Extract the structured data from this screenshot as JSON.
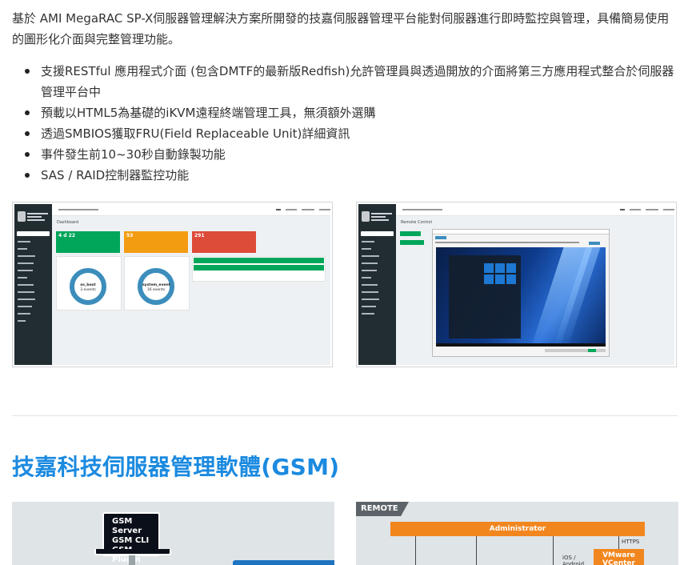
{
  "intro": {
    "text": "基於 AMI MegaRAC SP-X伺服器管理解決方案所開發的技嘉伺服器管理平台能對伺服器進行即時監控與管理，具備簡易使用的圖形化介面與完整管理功能。"
  },
  "features": [
    "支援RESTful 應用程式介面 (包含DMTF的最新版Redfish)允許管理員與透過開放的介面將第三方應用程式整合於伺服器管理平台中",
    "預載以HTML5為基礎的iKVM遠程終端管理工具，無須額外選購",
    "透過SMBIOS獲取FRU(Field Replaceable Unit)詳細資訊",
    "事件發生前10~30秒自動錄製功能",
    "SAS / RAID控制器監控功能"
  ],
  "screenshots": {
    "dashboard": {
      "page_title": "Dashboard",
      "tiles": [
        {
          "value": "4 d 22",
          "color": "#00a65a"
        },
        {
          "value": "53",
          "color": "#f39c12"
        },
        {
          "value": "291",
          "color": "#dd4b39"
        }
      ],
      "donuts": [
        {
          "label": "os_boot",
          "sub": "3 events"
        },
        {
          "label": "system_event",
          "sub": "16 events"
        }
      ]
    },
    "remote": {
      "page_title": "Remote Control"
    }
  },
  "gsm": {
    "heading": "技嘉科技伺服器管理軟體(GSM)",
    "server_box": [
      "GSM Server",
      "GSM CLI",
      "GSM Plugin"
    ]
  },
  "remote_diagram": {
    "tag": "REMOTE",
    "admin": "Administrator",
    "https": "HTTPS",
    "ios_android": "iOS /\nAndroid",
    "vmware": "VMware\nVCenter"
  },
  "colors": {
    "heading_blue": "#1b8ae0",
    "admin_orange": "#f2861e",
    "sidebar_dark": "#222d32"
  }
}
